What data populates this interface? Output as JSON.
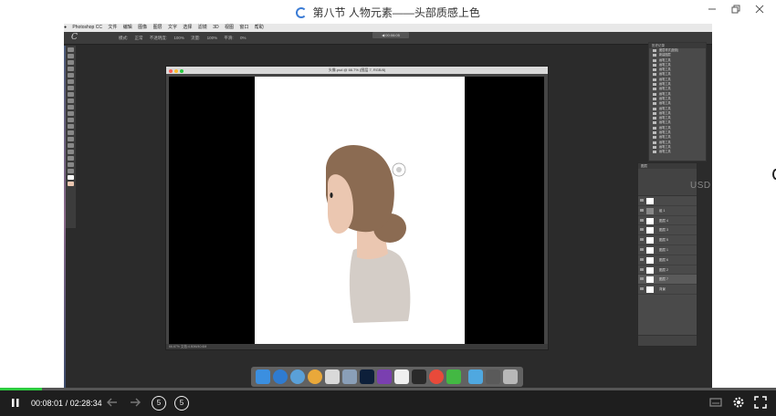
{
  "window": {
    "title": "第八节 人物元素——头部质感上色",
    "minimize_icon": "minimize-icon",
    "restore_icon": "restore-icon",
    "close_icon": "close-icon"
  },
  "screen_recording": {
    "mac_menu": [
      "Photoshop CC",
      "文件",
      "编辑",
      "图像",
      "图层",
      "文字",
      "选择",
      "滤镜",
      "3D",
      "视图",
      "窗口",
      "帮助"
    ],
    "ps_options": [
      "模式:",
      "正常",
      "不透明度:",
      "100%",
      "流量:",
      "100%",
      "平滑:",
      "0%"
    ],
    "ps_logo_text": "C",
    "time_badge": "◀ 00:06:05",
    "document_title": "头像.psd @ 66.7% (图层 7, RGB/8)",
    "document_status": "66.67%  文档:4.50M/40.6M",
    "history_panel_title": "历史记录",
    "history_items": [
      "图层样式(投影)",
      "新建图层",
      "画笔工具",
      "画笔工具",
      "画笔工具",
      "画笔工具",
      "画笔工具",
      "画笔工具",
      "画笔工具",
      "画笔工具",
      "画笔工具",
      "画笔工具",
      "画笔工具",
      "画笔工具",
      "画笔工具",
      "画笔工具",
      "画笔工具",
      "画笔工具",
      "画笔工具",
      "画笔工具",
      "画笔工具",
      "画笔工具"
    ],
    "layers_panel_title": "图层",
    "layers": [
      {
        "name": "",
        "selected": false
      },
      {
        "name": "组 1",
        "selected": false
      },
      {
        "name": "图层 4",
        "selected": false
      },
      {
        "name": "图层 3",
        "selected": false
      },
      {
        "name": "图层 5",
        "selected": false
      },
      {
        "name": "图层 1",
        "selected": false
      },
      {
        "name": "图层 6",
        "selected": false
      },
      {
        "name": "图层 2",
        "selected": false
      },
      {
        "name": "图层 7",
        "selected": true
      },
      {
        "name": "背景",
        "selected": false
      }
    ],
    "watermark_fragment": "USD"
  },
  "player": {
    "current_time": "00:08:01",
    "separator": "/",
    "duration": "02:28:34",
    "progress": 0.054,
    "skip_back_label": "5",
    "skip_forward_label": "5",
    "icons": {
      "pause": "pause-icon",
      "prev": "previous-icon",
      "next": "next-icon",
      "subtitle": "subtitle-icon",
      "settings": "gear-icon",
      "fullscreen": "fullscreen-icon"
    }
  },
  "colors": {
    "progress": "#2ecc40",
    "controls_bg": "#1e1e1e",
    "hair": "#8b6b52",
    "skin": "#ebc7b1",
    "shirt": "#d4cdc7"
  }
}
